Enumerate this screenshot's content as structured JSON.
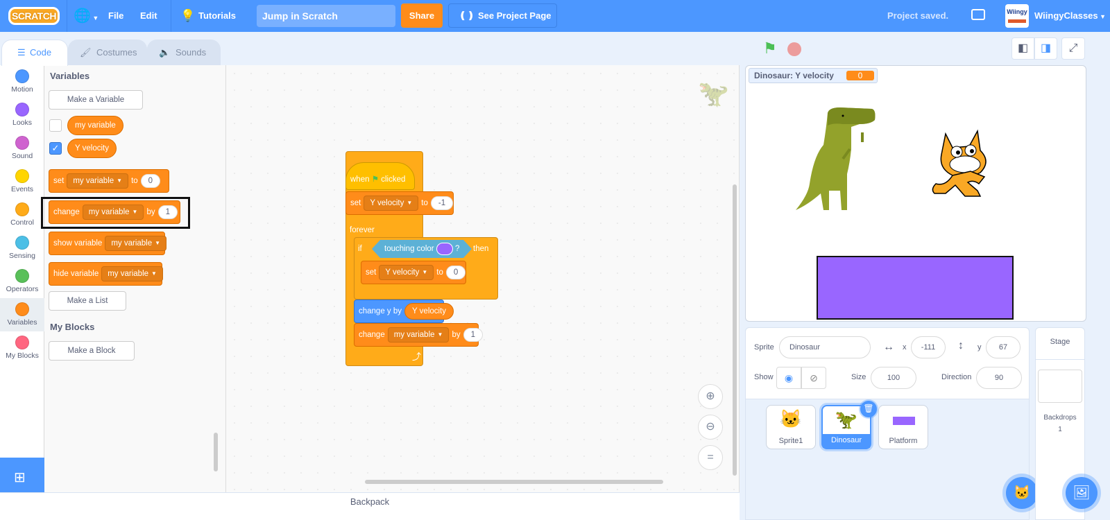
{
  "menubar": {
    "logo": "SCRATCH",
    "file": "File",
    "edit": "Edit",
    "tutorials": "Tutorials",
    "project_title": "Jump in Scratch",
    "share": "Share",
    "see_project_page": "See Project Page",
    "status": "Project saved.",
    "username": "WiingyClasses",
    "avatar_text": "Wiingy"
  },
  "tabs": [
    {
      "label": "Code",
      "active": true
    },
    {
      "label": "Costumes",
      "active": false
    },
    {
      "label": "Sounds",
      "active": false
    }
  ],
  "categories": [
    {
      "label": "Motion",
      "color": "#4c97ff"
    },
    {
      "label": "Looks",
      "color": "#9966ff"
    },
    {
      "label": "Sound",
      "color": "#cf63cf"
    },
    {
      "label": "Events",
      "color": "#ffd500"
    },
    {
      "label": "Control",
      "color": "#ffab19"
    },
    {
      "label": "Sensing",
      "color": "#4cbfe6"
    },
    {
      "label": "Operators",
      "color": "#59c059"
    },
    {
      "label": "Variables",
      "color": "#ff8c1a"
    },
    {
      "label": "My Blocks",
      "color": "#ff6680"
    }
  ],
  "palette": {
    "heading_variables": "Variables",
    "make_variable": "Make a Variable",
    "variables": [
      {
        "name": "my variable",
        "checked": false
      },
      {
        "name": "Y velocity",
        "checked": true
      }
    ],
    "blocks": {
      "set": {
        "label": "set",
        "var": "my variable",
        "to": "to",
        "value": "0"
      },
      "change": {
        "label": "change",
        "var": "my variable",
        "by": "by",
        "value": "1"
      },
      "show": {
        "label": "show variable",
        "var": "my variable"
      },
      "hide": {
        "label": "hide variable",
        "var": "my variable"
      }
    },
    "make_list": "Make a List",
    "heading_myblocks": "My Blocks",
    "make_block": "Make a Block"
  },
  "script": {
    "hat": {
      "when": "when",
      "clicked": "clicked"
    },
    "set1": {
      "label": "set",
      "var": "Y velocity",
      "to": "to",
      "value": "-1"
    },
    "forever": "forever",
    "if": {
      "label": "if",
      "cond": "touching color",
      "q": "?",
      "then": "then",
      "color": "#9966ff"
    },
    "set2": {
      "label": "set",
      "var": "Y velocity",
      "to": "to",
      "value": "0"
    },
    "changey": {
      "label": "change y by",
      "reporter": "Y velocity"
    },
    "change": {
      "label": "change",
      "var": "my variable",
      "by": "by",
      "value": "1"
    }
  },
  "stage": {
    "monitor_label": "Dinosaur: Y velocity",
    "monitor_value": "0",
    "platform_color": "#9966ff"
  },
  "sprite_info": {
    "sprite_label": "Sprite",
    "sprite_name": "Dinosaur",
    "x_label": "x",
    "x": "-111",
    "y_label": "y",
    "y": "67",
    "show_label": "Show",
    "size_label": "Size",
    "size": "100",
    "direction_label": "Direction",
    "direction": "90"
  },
  "sprites": [
    {
      "name": "Sprite1",
      "selected": false
    },
    {
      "name": "Dinosaur",
      "selected": true
    },
    {
      "name": "Platform",
      "selected": false
    }
  ],
  "stage_panel": {
    "title": "Stage",
    "backdrops_label": "Backdrops",
    "backdrops_count": "1"
  },
  "backpack": "Backpack"
}
